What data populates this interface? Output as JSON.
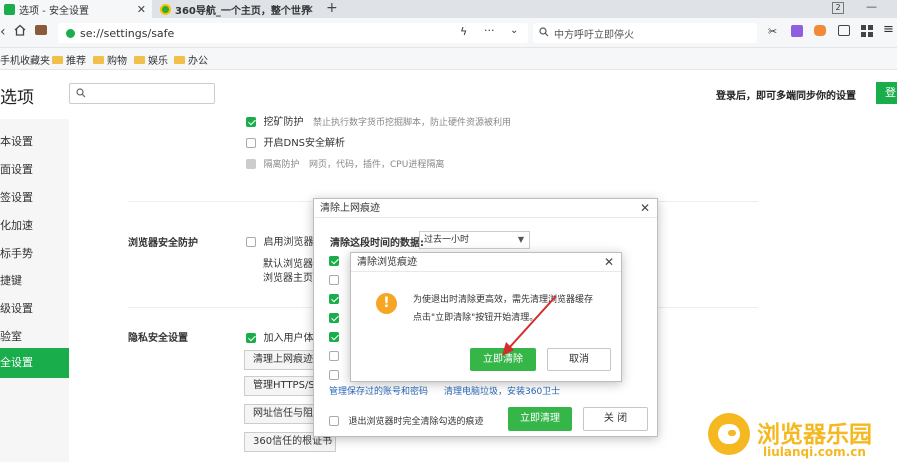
{
  "tabs": [
    {
      "label": "选项 - 安全设置",
      "active": true
    },
    {
      "label": "360导航_一个主页，整个世界",
      "active": false
    }
  ],
  "new_tab_label": "+",
  "window": {
    "tab_count": "2"
  },
  "address": {
    "url": "se://settings/safe"
  },
  "search": {
    "placeholder": "中方呼吁立即停火"
  },
  "bookmarks": [
    "手机收藏夹",
    "推荐",
    "购物",
    "娱乐",
    "办公"
  ],
  "page": {
    "title": "选项",
    "search_placeholder": "",
    "sync_text": "登录后，即可多端同步你的设置",
    "login_button": "登"
  },
  "sidebar": {
    "items": [
      "本设置",
      "面设置",
      "签设置",
      "化加速",
      "标手势",
      "捷键",
      "级设置",
      "验室",
      "全设置"
    ],
    "active_index": 8
  },
  "content": {
    "mining_label": "挖矿防护",
    "mining_desc": "禁止执行数字货币挖掘脚本，防止硬件资源被利用",
    "dns_label": "开启DNS安全解析",
    "isolation_label": "隔离防护",
    "isolation_desc": "网页，代码，插件，CPU进程隔离",
    "browser_protect_heading": "浏览器安全防护",
    "browser_protect_option": "启用浏览器安",
    "default_browser": "默认浏览器",
    "browser_home": "浏览器主页",
    "privacy_heading": "隐私安全设置",
    "privacy_option": "加入用户体验",
    "buttons": [
      "清理上网痕迹",
      "管理HTTPS/S",
      "网址信任与阻",
      "360信任的根证书"
    ]
  },
  "clear_dialog": {
    "title": "清除上网痕迹",
    "period_label": "清除这段时间的数据:",
    "period_value": "过去一小时",
    "checkboxes": [
      true,
      false,
      true,
      true,
      true,
      false,
      false
    ],
    "link_passwords": "管理保存过的账号和密码",
    "link_junk": "清理电脑垃圾，安装360卫士",
    "exit_clear_label": "退出浏览器时完全清除勾选的痕迹",
    "confirm_button": "立即清理",
    "close_button": "关 闭"
  },
  "alert_dialog": {
    "title": "清除浏览痕迹",
    "message_line1": "为使退出时清除更高效，需先清理浏览器缓存",
    "message_line2": "点击\"立即清除\"按钮开始清理。",
    "confirm_button": "立即清除",
    "cancel_button": "取消"
  },
  "watermark": {
    "cn": "浏览器乐园",
    "url": "liulanqi.com.cn"
  },
  "colors": {
    "accent": "#1aad4b",
    "arrow": "#d62b2b",
    "watermark": "#f5b820"
  }
}
